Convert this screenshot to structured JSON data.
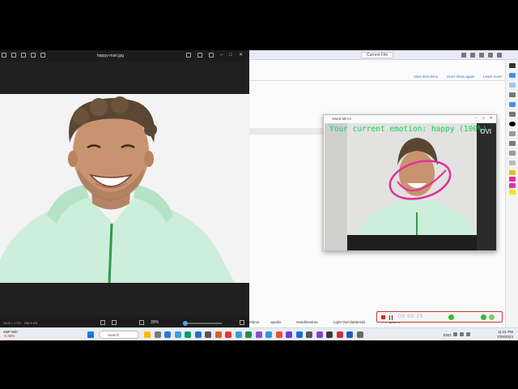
{
  "photo_viewer": {
    "title": "happy-man.jpg",
    "dimensions": "2400 × 1792",
    "file_size": "208.5 KB",
    "zoom": "39%"
  },
  "ide": {
    "current_file": "Current File",
    "notice_links": [
      "View directions",
      "Don't show again",
      "Learn more"
    ],
    "bottom_tabs": [
      "rsbme",
      "opodio",
      "HandGesture",
      "Light Owl (Material)",
      "# spaces"
    ]
  },
  "mirror": {
    "title": "Swed Mirror",
    "emotion_overlay": "Your current emotion: happy (100%)",
    "watermark": "OVI"
  },
  "recorder": {
    "time": "00:00:25"
  },
  "taskbar": {
    "weather_title": "S&P 500",
    "weather_sub": "-0.35%",
    "search_placeholder": "Search",
    "time": "11:31 PM",
    "date": "7/29/2023",
    "lang": "ENG"
  },
  "colors": {
    "overlay_text": "#19d05a",
    "jacket": "#c8ead6",
    "stroke": "#e0309a",
    "recorder_border": "#cc3333"
  }
}
